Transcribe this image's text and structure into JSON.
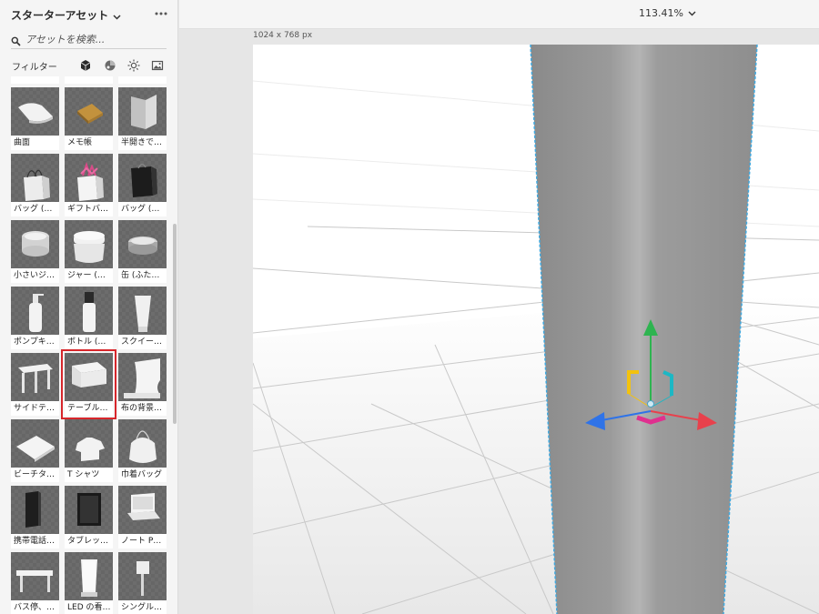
{
  "panel": {
    "title": "スターターアセット",
    "search_placeholder": "アセットを検索...",
    "filter_label": "フィルター",
    "filter_icons": [
      "3d-model-icon",
      "material-icon",
      "light-icon",
      "image-icon"
    ]
  },
  "assets": [
    {
      "label": "",
      "icon": "cut-off-row"
    },
    {
      "label": "",
      "icon": "cut-off-row"
    },
    {
      "label": "",
      "icon": "cut-off-row"
    },
    {
      "label": "曲面",
      "icon": "curved-paper-icon"
    },
    {
      "label": "メモ帳",
      "icon": "notepad-icon"
    },
    {
      "label": "半開きで…",
      "icon": "half-open-book-icon"
    },
    {
      "label": "バッグ (…",
      "icon": "paper-bag-icon"
    },
    {
      "label": "ギフトバ…",
      "icon": "gift-bag-icon"
    },
    {
      "label": "バッグ (…",
      "icon": "black-bag-icon"
    },
    {
      "label": "小さいジ…",
      "icon": "small-jar-icon"
    },
    {
      "label": "ジャー (…",
      "icon": "jar-icon"
    },
    {
      "label": "缶 (ふた…",
      "icon": "tin-can-icon"
    },
    {
      "label": "ポンプキ…",
      "icon": "pump-bottle-icon"
    },
    {
      "label": "ボトル (…",
      "icon": "bottle-icon"
    },
    {
      "label": "スクイー…",
      "icon": "squeeze-tube-icon"
    },
    {
      "label": "サイドテ…",
      "icon": "side-table-icon"
    },
    {
      "label": "テーブル…",
      "icon": "table-cloth-icon",
      "selected": true
    },
    {
      "label": "布の背景…",
      "icon": "cloth-backdrop-icon"
    },
    {
      "label": "ビーチタ…",
      "icon": "beach-towel-icon"
    },
    {
      "label": "T シャツ",
      "icon": "tshirt-icon"
    },
    {
      "label": "巾着バッグ",
      "icon": "drawstring-bag-icon"
    },
    {
      "label": "携帯電話…",
      "icon": "mobile-phone-icon"
    },
    {
      "label": "タブレッ…",
      "icon": "tablet-icon"
    },
    {
      "label": "ノート P…",
      "icon": "laptop-icon"
    },
    {
      "label": "バス停、…",
      "icon": "bus-stop-icon"
    },
    {
      "label": "LED の看…",
      "icon": "led-sign-icon"
    },
    {
      "label": "シングル…",
      "icon": "single-sign-icon"
    }
  ],
  "toolbar": {
    "zoom": "113.41%"
  },
  "canvas": {
    "size_label": "1024 x 768 px"
  },
  "colors": {
    "selection": "#d7262b",
    "gizmo_x": "#e8414c",
    "gizmo_y": "#2eb450",
    "gizmo_z": "#2f73e8",
    "gizmo_yellow": "#f3c20e",
    "gizmo_cyan": "#1cb7c4",
    "gizmo_magenta": "#e0308f"
  }
}
